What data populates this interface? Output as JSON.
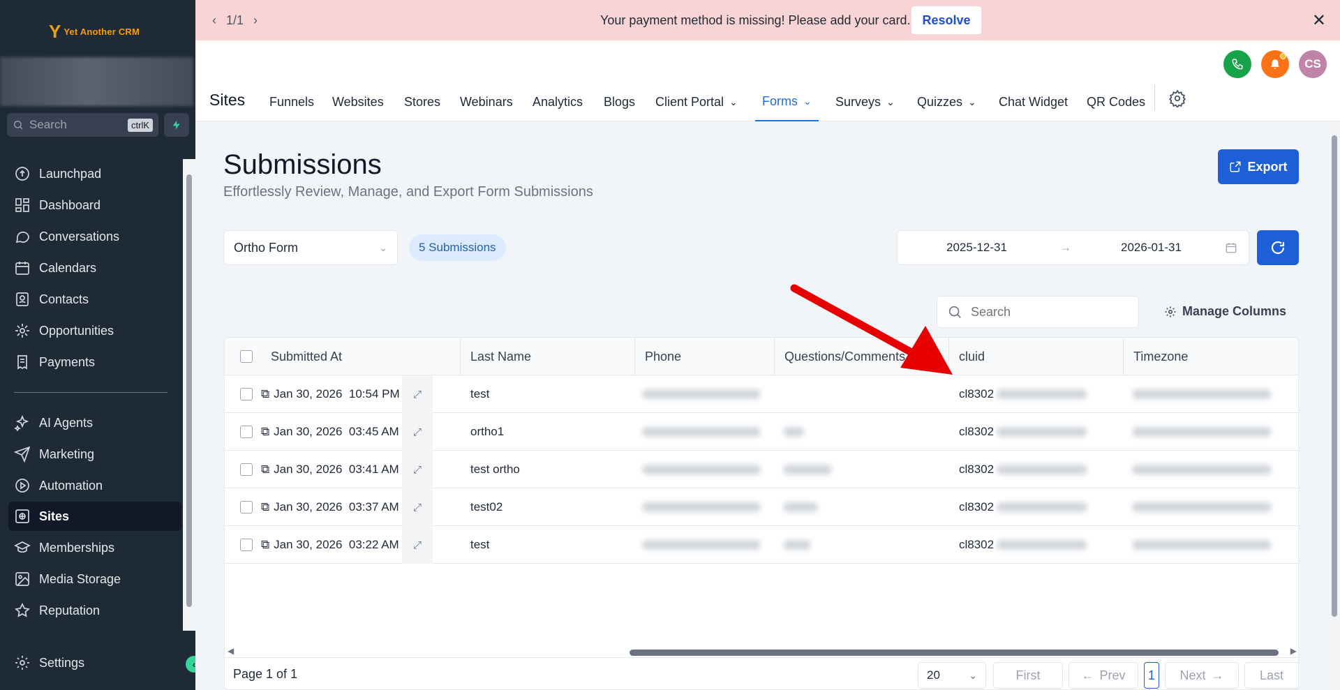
{
  "sidebar": {
    "logo_text": "Yet Another CRM",
    "search_placeholder": "Search",
    "search_shortcut": "ctrlK",
    "items": [
      {
        "label": "Launchpad"
      },
      {
        "label": "Dashboard"
      },
      {
        "label": "Conversations"
      },
      {
        "label": "Calendars"
      },
      {
        "label": "Contacts"
      },
      {
        "label": "Opportunities"
      },
      {
        "label": "Payments"
      },
      {
        "label": "AI Agents"
      },
      {
        "label": "Marketing"
      },
      {
        "label": "Automation"
      },
      {
        "label": "Sites"
      },
      {
        "label": "Memberships"
      },
      {
        "label": "Media Storage"
      },
      {
        "label": "Reputation"
      },
      {
        "label": "Settings"
      }
    ],
    "active_item": "Sites"
  },
  "banner": {
    "pager": "1/1",
    "message": "Your payment method is missing! Please add your card.",
    "resolve_label": "Resolve"
  },
  "header": {
    "avatar_initials": "CS",
    "section_title": "Sites",
    "tabs": [
      {
        "label": "Funnels"
      },
      {
        "label": "Websites"
      },
      {
        "label": "Stores"
      },
      {
        "label": "Webinars"
      },
      {
        "label": "Analytics"
      },
      {
        "label": "Blogs"
      },
      {
        "label": "Client Portal"
      },
      {
        "label": "Forms"
      },
      {
        "label": "Surveys"
      },
      {
        "label": "Quizzes"
      },
      {
        "label": "Chat Widget"
      },
      {
        "label": "QR Codes"
      }
    ],
    "active_tab": "Forms"
  },
  "page": {
    "title": "Submissions",
    "subtitle": "Effortlessly Review, Manage, and Export Form Submissions",
    "export_label": "Export",
    "form_select_value": "Ortho Form",
    "submission_count": "5 Submissions",
    "date_start": "2025-12-31",
    "date_end": "2026-01-31",
    "search_placeholder": "Search",
    "manage_columns_label": "Manage Columns"
  },
  "table": {
    "columns": [
      "Submitted At",
      "Last Name",
      "Phone",
      "Questions/Comments",
      "cluid",
      "Timezone"
    ],
    "rows": [
      {
        "submitted_at": "Jan 30, 2026  10:54 PM",
        "last_name": "test",
        "cluid": "cl8302"
      },
      {
        "submitted_at": "Jan 30, 2026  03:45 AM",
        "last_name": "ortho1",
        "cluid": "cl8302"
      },
      {
        "submitted_at": "Jan 30, 2026  03:41 AM",
        "last_name": "test ortho",
        "cluid": "cl8302"
      },
      {
        "submitted_at": "Jan 30, 2026  03:37 AM",
        "last_name": "test02",
        "cluid": "cl8302"
      },
      {
        "submitted_at": "Jan 30, 2026  03:22 AM",
        "last_name": "test",
        "cluid": "cl8302"
      }
    ]
  },
  "pagination": {
    "page_info": "Page 1 of 1",
    "page_size": "20",
    "first_label": "First",
    "prev_label": "Prev",
    "current_page": "1",
    "next_label": "Next",
    "last_label": "Last"
  },
  "colors": {
    "sidebar_bg": "#1f2a37",
    "banner_bg": "#f9d4d4",
    "accent_blue": "#1d5fd7",
    "annotation_red": "#e60000"
  }
}
